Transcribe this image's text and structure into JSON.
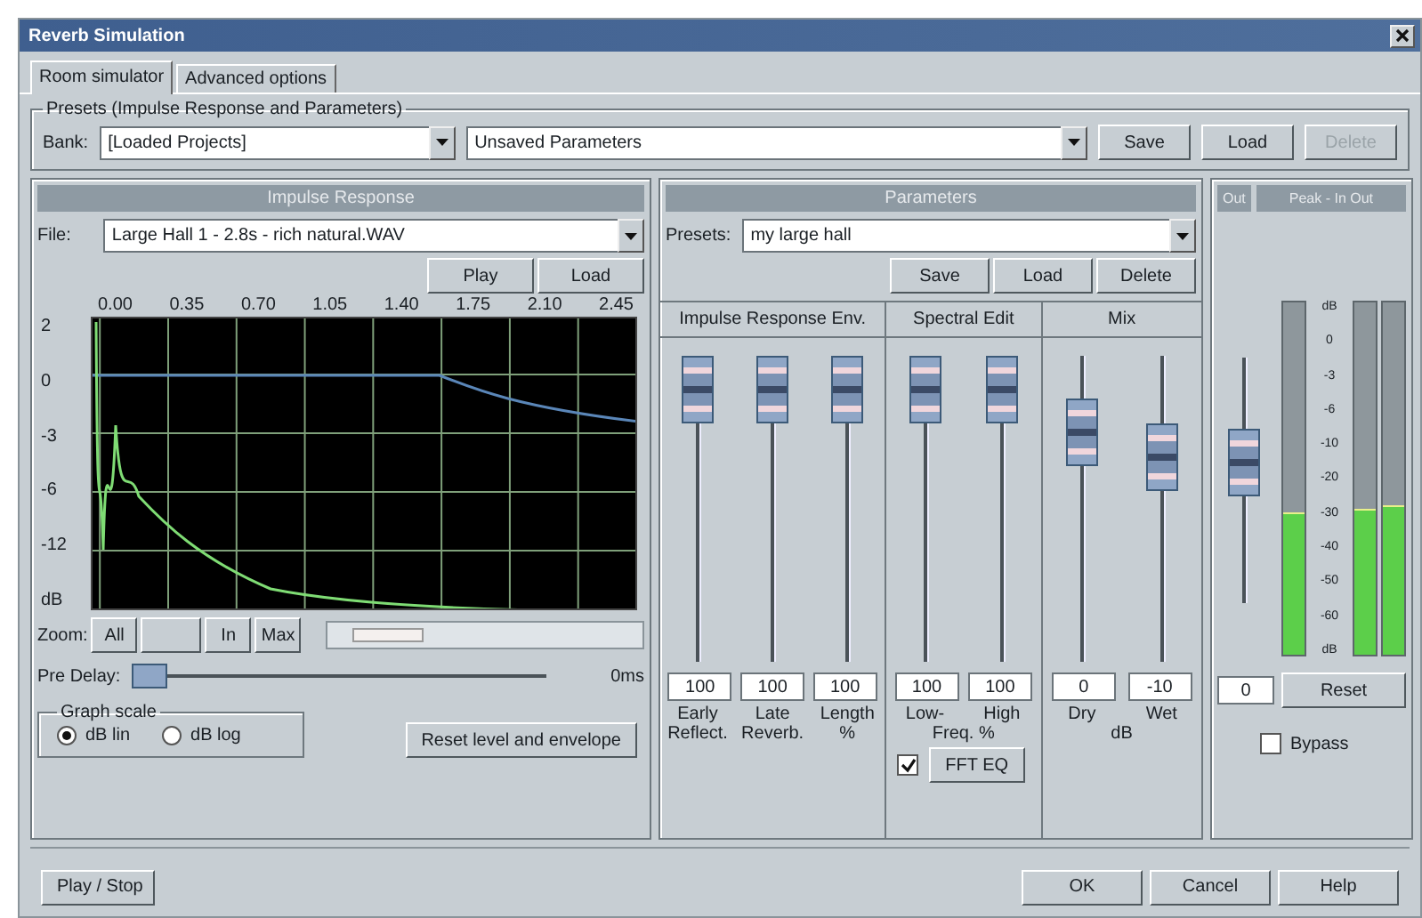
{
  "window": {
    "title": "Reverb Simulation"
  },
  "tabs": [
    {
      "label": "Room simulator",
      "selected": true
    },
    {
      "label": "Advanced options",
      "selected": false
    }
  ],
  "presets": {
    "title": "Presets (Impulse Response and Parameters)",
    "bank_label": "Bank:",
    "bank": "[Loaded Projects]",
    "preset": "Unsaved Parameters",
    "buttons": [
      {
        "label": "Save",
        "disabled": false
      },
      {
        "label": "Load",
        "disabled": false
      },
      {
        "label": "Delete",
        "disabled": true
      }
    ]
  },
  "impulse": {
    "title": "Impulse Response",
    "file_label": "File:",
    "file": "Large Hall 1 - 2.8s - rich natural.WAV",
    "buttons": [
      "Play",
      "Load"
    ],
    "xticks": [
      "0.00",
      "0.35",
      "0.70",
      "1.05",
      "1.40",
      "1.75",
      "2.10",
      "2.45"
    ],
    "yticks": [
      "2",
      "0",
      "-3",
      "-6",
      "-12",
      "dB"
    ],
    "zoom_label": "Zoom:",
    "zoom_buttons": [
      {
        "label": "All",
        "disabled": false
      },
      {
        "disabled": true
      },
      {
        "label": "In",
        "disabled": false
      },
      {
        "label": "Max",
        "disabled": false
      }
    ],
    "pre_delay": {
      "label": "Pre Delay:",
      "level": 0,
      "reading": "0ms"
    },
    "scale": {
      "title": "Graph scale",
      "options": [
        {
          "label": "dB lin",
          "selected": true
        },
        {
          "label": "dB log",
          "selected": false
        }
      ]
    },
    "reset": "Reset level and envelope"
  },
  "parameters": {
    "title": "Parameters",
    "presets_label": "Presets:",
    "preset": "my large hall",
    "buttons": [
      "Save",
      "Load",
      "Delete"
    ],
    "groups": [
      {
        "title": "Impulse Response Env.",
        "sliders": [
          {
            "value": "100",
            "label": "Early Reflect.",
            "level": 1
          },
          {
            "value": "100",
            "label": "Late Reverb.",
            "level": 1
          },
          {
            "value": "100",
            "label": "Length %",
            "level": 1
          }
        ]
      },
      {
        "title": "Spectral Edit",
        "sliders": [
          {
            "value": "100",
            "label": "Low-",
            "level": 1
          },
          {
            "value": "100",
            "label": "High",
            "level": 1
          }
        ],
        "note": "Freq. %",
        "fft": {
          "checked": true,
          "label": "FFT EQ"
        }
      },
      {
        "title": "Mix",
        "sliders": [
          {
            "value": "0",
            "label": "Dry",
            "level": 0.82
          },
          {
            "value": "-10",
            "label": "Wet",
            "level": 0.72
          }
        ],
        "note": "dB"
      }
    ]
  },
  "output": {
    "header": [
      "Out",
      "Peak - In Out"
    ],
    "level": 0.6,
    "value": "0",
    "reset": "Reset",
    "scale": [
      "dB",
      "0",
      "-3",
      "-6",
      "-10",
      "-20",
      "-30",
      "-40",
      "-50",
      "-60",
      "dB"
    ],
    "meters": [
      {
        "level": 0.4
      },
      {
        "level": 0.41
      },
      {
        "level": 0.42
      }
    ],
    "bypass": {
      "label": "Bypass",
      "checked": false
    }
  },
  "footer": {
    "play": "Play / Stop",
    "buttons": [
      "OK",
      "Cancel",
      "Help"
    ]
  }
}
